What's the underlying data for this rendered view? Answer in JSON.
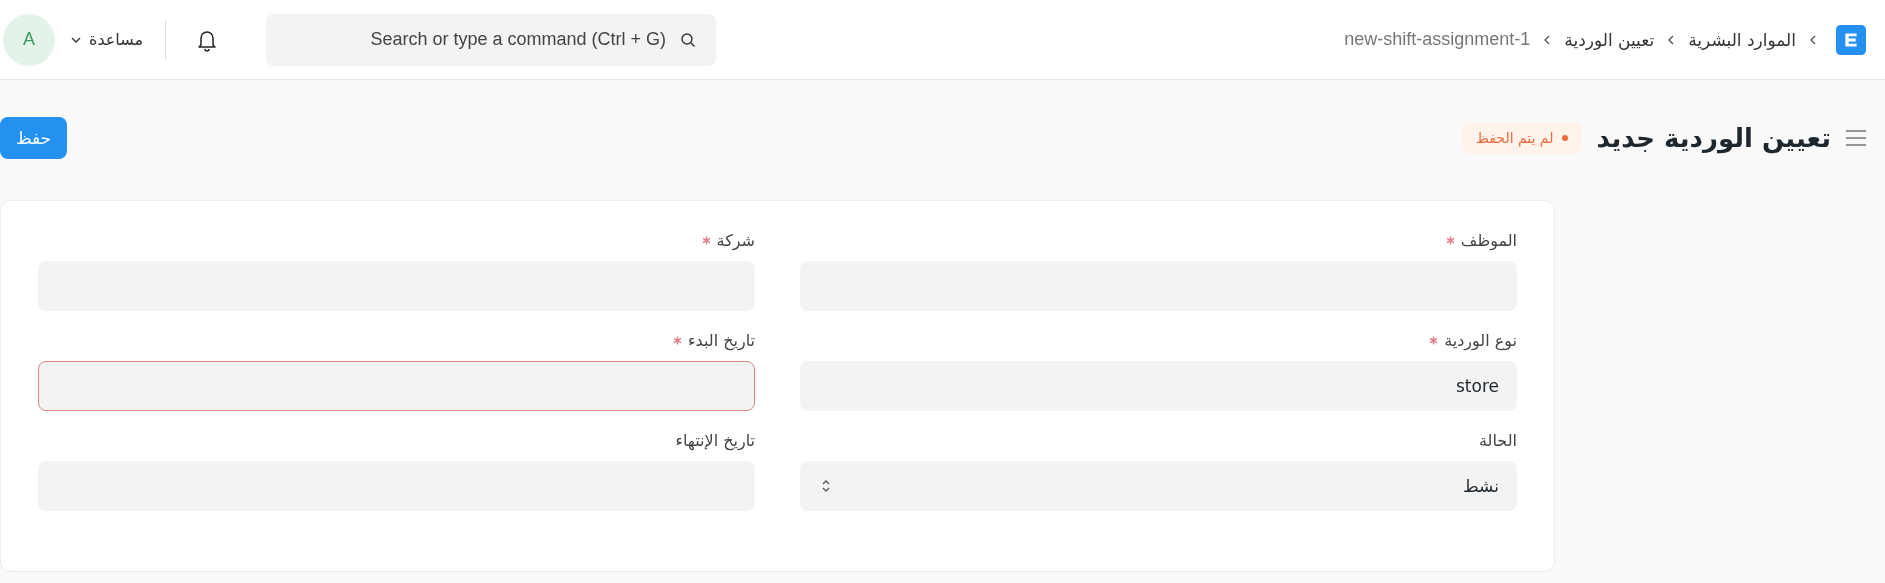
{
  "navbar": {
    "breadcrumbs": [
      {
        "label": "الموارد البشرية",
        "current": false
      },
      {
        "label": "تعيين الوردية",
        "current": false
      },
      {
        "label": "new-shift-assignment-1",
        "current": true
      }
    ],
    "search": {
      "placeholder": "Search or type a command (Ctrl + G)"
    },
    "help": "مساعدة",
    "avatar": "A"
  },
  "page_header": {
    "title": "تعيين الوردية جديد",
    "status": "لم يتم الحفظ",
    "save_button": "حفظ"
  },
  "form": {
    "columns": [
      {
        "fields": [
          {
            "label": "الموظف",
            "required": true,
            "kind": "text",
            "error": false
          },
          {
            "label": "نوع الوردية",
            "required": true,
            "kind": "text",
            "value": "store",
            "error": false
          },
          {
            "label": "الحالة",
            "required": false,
            "kind": "select",
            "value": "نشط",
            "error": false
          }
        ]
      },
      {
        "fields": [
          {
            "label": "شركة",
            "required": true,
            "kind": "text",
            "error": false
          },
          {
            "label": "تاريخ البدء",
            "required": true,
            "kind": "text",
            "error": true
          },
          {
            "label": "تاريخ الإنتهاء",
            "required": false,
            "kind": "text",
            "error": false
          }
        ]
      }
    ]
  }
}
